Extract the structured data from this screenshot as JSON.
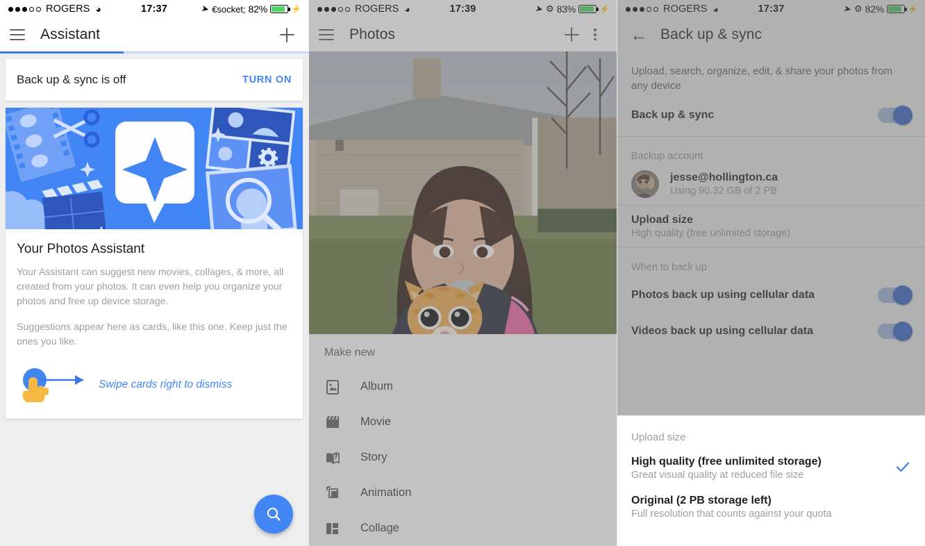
{
  "panels": [
    {
      "status": {
        "carrier": "ROGERS",
        "time": "17:37",
        "battery_pct": "82%",
        "wifi_icon": "wifi-icon",
        "location_icon": "location-arrow-icon",
        "bluetooth_icon": "bluetooth-icon",
        "charging_icon": "charging-bolt-icon"
      },
      "appbar": {
        "title": "Assistant",
        "menu_icon": "hamburger-menu-icon",
        "add_icon": "plus-icon"
      },
      "progress": {
        "value": 40
      },
      "backup_card": {
        "text": "Back up & sync is off",
        "action": "TURN ON"
      },
      "assistant_card": {
        "title": "Your Photos Assistant",
        "paragraph1": "Your Assistant can suggest new movies, collages, & more, all created from your photos. It can even help you organize your photos and free up device storage.",
        "paragraph2": "Suggestions appear here as cards, like this one. Keep just the ones you like.",
        "swipe_hint": "Swipe cards right to dismiss"
      },
      "fab": {
        "icon": "search-icon"
      }
    },
    {
      "status": {
        "carrier": "ROGERS",
        "time": "17:39",
        "battery_pct": "83%"
      },
      "appbar": {
        "title": "Photos",
        "menu_icon": "hamburger-menu-icon",
        "add_icon": "plus-icon",
        "overflow_icon": "kebab-menu-icon"
      },
      "make_new": {
        "label": "Make new",
        "items": [
          {
            "label": "Album",
            "icon": "album-icon"
          },
          {
            "label": "Movie",
            "icon": "movie-clapper-icon"
          },
          {
            "label": "Story",
            "icon": "story-book-icon"
          },
          {
            "label": "Animation",
            "icon": "animation-stack-icon"
          },
          {
            "label": "Collage",
            "icon": "collage-grid-icon"
          }
        ]
      }
    },
    {
      "status": {
        "carrier": "ROGERS",
        "time": "17:37",
        "battery_pct": "82%"
      },
      "appbar": {
        "title": "Back up & sync",
        "back_icon": "back-arrow-icon"
      },
      "subtitle": "Upload, search, organize, edit, & share your photos from any device",
      "backup_sync_row": {
        "label": "Back up & sync",
        "toggle": "on"
      },
      "backup_account": {
        "section": "Backup account",
        "email": "jesse@hollington.ca",
        "usage": "Using 90.32 GB of 2 PB"
      },
      "upload_size_row": {
        "label": "Upload size",
        "value": "High quality (free unlimited storage)"
      },
      "when_to_back_up": {
        "section": "When to back up",
        "rows": [
          {
            "label": "Photos back up using cellular data",
            "toggle": "on"
          },
          {
            "label": "Videos back up using cellular data",
            "toggle": "on"
          }
        ]
      },
      "sheet": {
        "title": "Upload size",
        "options": [
          {
            "title": "High quality (free unlimited storage)",
            "sub": "Great visual quality at reduced file size",
            "selected": true,
            "check_icon": "checkmark-icon"
          },
          {
            "title": "Original (2 PB storage left)",
            "sub": "Full resolution that counts against your quota",
            "selected": false
          }
        ]
      }
    }
  ],
  "colors": {
    "accent": "#4285f4",
    "toggle_on": "#3367d6",
    "battery_green": "#4cd964",
    "dim": "#6e6e6e",
    "card_bg": "#ffffff",
    "page_bg": "#eeeeee"
  }
}
